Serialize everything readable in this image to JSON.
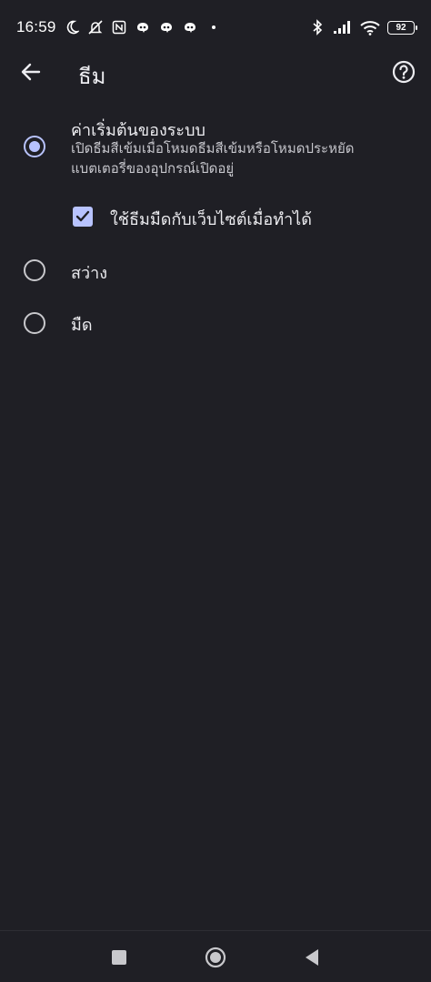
{
  "status_bar": {
    "time": "16:59",
    "battery": "92",
    "icons_left": [
      "moon-icon",
      "mute-icon",
      "nfc-icon",
      "notification-icon",
      "notification-icon",
      "notification-icon",
      "dot-icon"
    ],
    "icons_right": [
      "bluetooth-icon",
      "signal-icon",
      "wifi-icon",
      "battery-icon"
    ]
  },
  "app_bar": {
    "title": "ธีม",
    "back_icon": "back-arrow-icon",
    "help_icon": "help-icon"
  },
  "options": {
    "system": {
      "title": "ค่าเริ่มต้นของระบบ",
      "description": "เปิดธีมสีเข้มเมื่อโหมดธีมสีเข้มหรือโหมดประหยัดแบตเตอรี่ของอุปกรณ์เปิดอยู่",
      "selected": true
    },
    "dark_websites": {
      "label": "ใช้ธีมมืดกับเว็บไซต์เมื่อทำได้",
      "checked": true
    },
    "light": {
      "title": "สว่าง",
      "selected": false
    },
    "dark": {
      "title": "มืด",
      "selected": false
    }
  },
  "colors": {
    "background": "#1f1f25",
    "accent": "#b8c3ff",
    "text": "#ececf0"
  },
  "nav_bar": {
    "icons": [
      "recents-icon",
      "home-icon",
      "back-icon"
    ]
  }
}
